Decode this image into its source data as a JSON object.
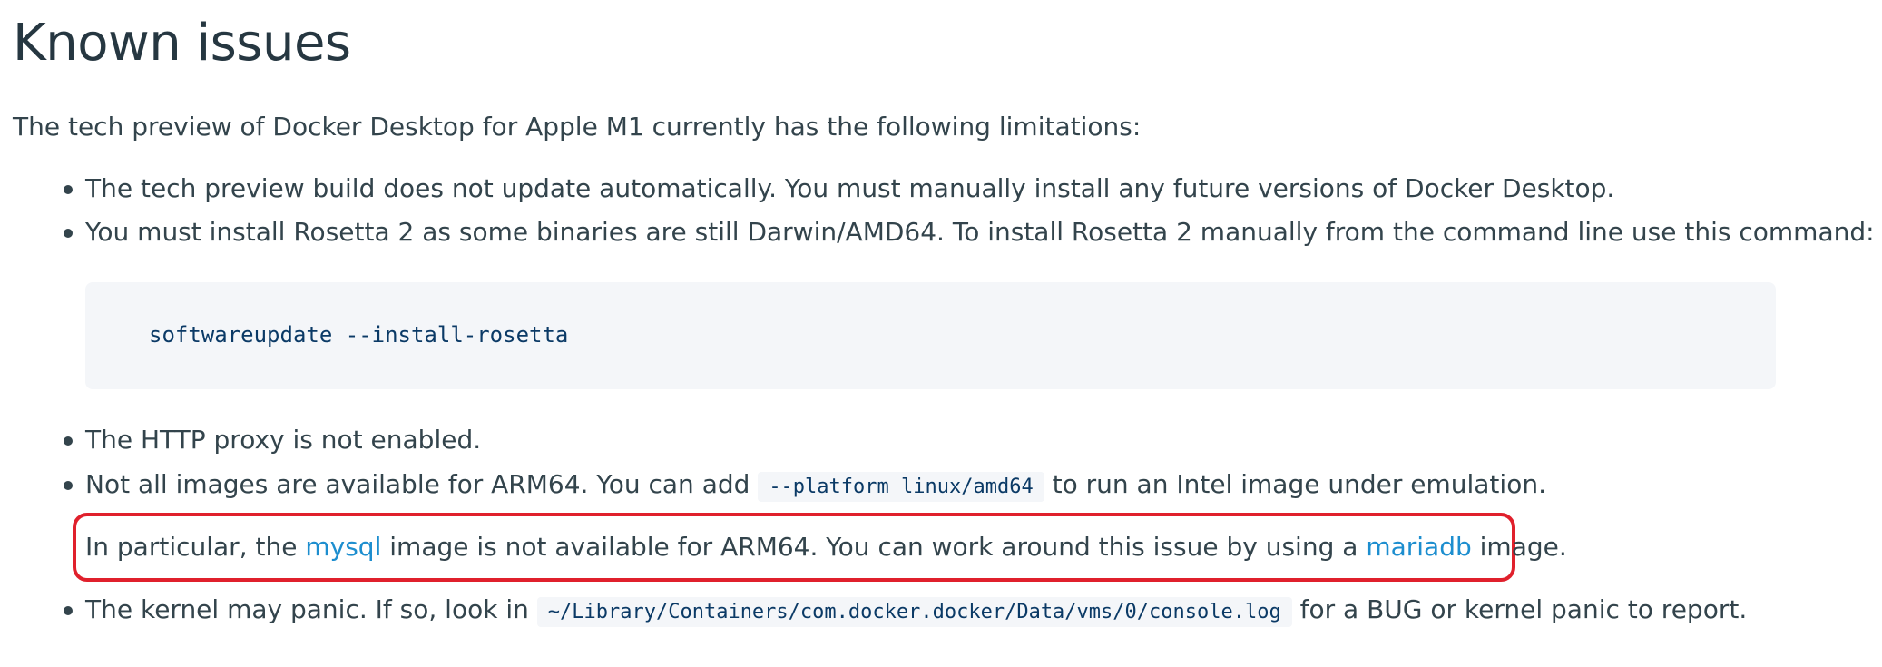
{
  "heading": "Known issues",
  "intro": "The tech preview of Docker Desktop for Apple M1 currently has the following limitations:",
  "items": [
    {
      "text": "The tech preview build does not update automatically. You must manually install any future versions of Docker Desktop."
    },
    {
      "text": "You must install Rosetta 2 as some binaries are still Darwin/AMD64. To install Rosetta 2 manually from the command line use this command:"
    },
    {
      "text": "The HTTP proxy is not enabled."
    },
    {
      "before": "Not all images are available for ARM64. You can add ",
      "code": "--platform linux/amd64",
      "after": " to run an Intel image under emulation."
    },
    {
      "before": "The kernel may panic. If so, look in ",
      "code": "~/Library/Containers/com.docker.docker/Data/vms/0/console.log",
      "after": " for a BUG or kernel panic to report."
    }
  ],
  "code_block": "softwareupdate --install-rosetta",
  "note": {
    "before": "In particular, the ",
    "link1": "mysql",
    "middle": " image is not available for ARM64. You can work around this issue by using a ",
    "link2": "mariadb",
    "after": " image."
  },
  "colors": {
    "text": "#33444c",
    "heading": "#263741",
    "link": "#1d8ecf",
    "code_bg": "#f4f6f9",
    "code_text": "#0b3a66",
    "highlight_border": "#e0202c"
  }
}
